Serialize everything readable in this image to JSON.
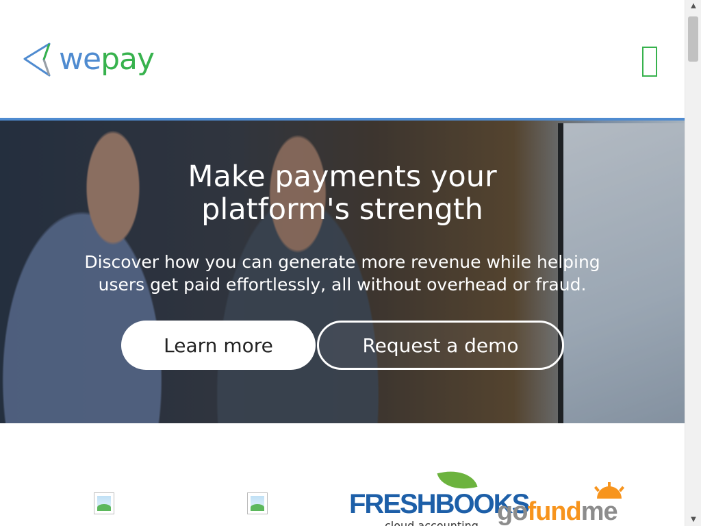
{
  "header": {
    "brand_we": "we",
    "brand_pay": "pay",
    "menu_icon": "menu-icon"
  },
  "hero": {
    "title_line1": "Make payments your",
    "title_line2": "platform's strength",
    "subtitle_line1": "Discover how you can generate more revenue while helping",
    "subtitle_line2": "users get paid effortlessly, all without overhead or fraud.",
    "learn_more": "Learn more",
    "request_demo": "Request a demo"
  },
  "partners": {
    "freshbooks": "FRESHBOOKS",
    "freshbooks_tag": "cloud accounting",
    "gofundme_go": "go",
    "gofundme_fund": "fund",
    "gofundme_me": "me"
  },
  "colors": {
    "brand_blue": "#4f8bd0",
    "brand_green": "#37b24d"
  }
}
